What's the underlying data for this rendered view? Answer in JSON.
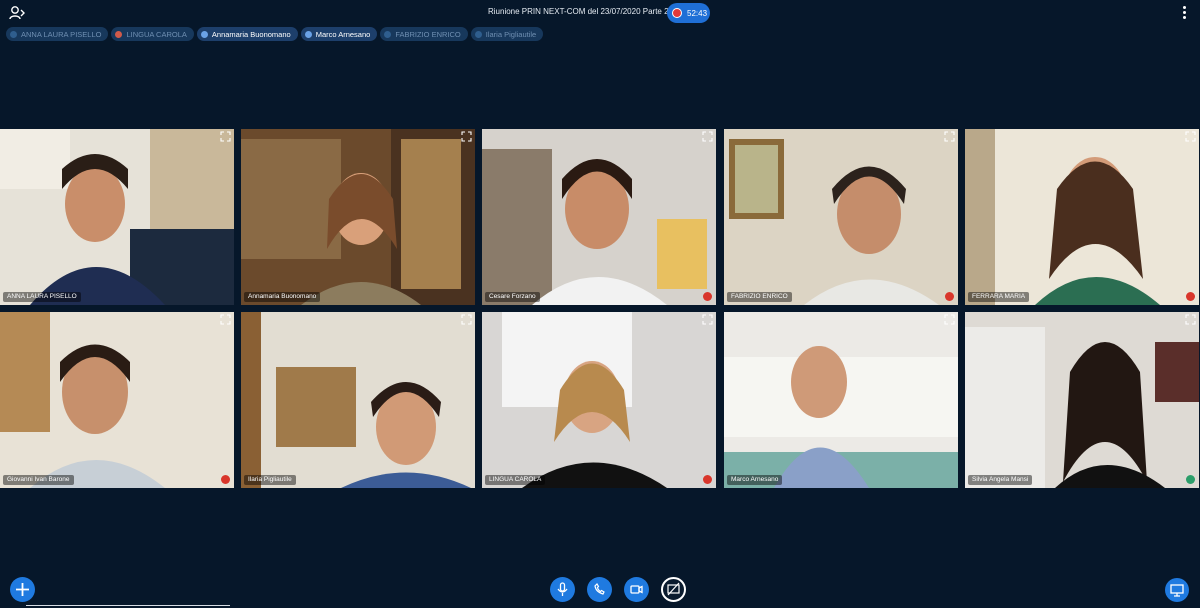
{
  "meeting": {
    "title": "Riunione PRIN NEXT-COM del 23/07/2020 Parte 2",
    "timer": "52:43"
  },
  "participant_pills": [
    {
      "label": "ANNA LAURA PISELLO",
      "active": false
    },
    {
      "label": "LINGUA CAROLA",
      "active": false
    },
    {
      "label": "Annamaria Buonomano",
      "active": true
    },
    {
      "label": "Marco Arnesano",
      "active": true
    },
    {
      "label": "FABRIZIO ENRICO",
      "active": false
    },
    {
      "label": "Ilaria Pigliautile",
      "active": false
    }
  ],
  "tiles": [
    {
      "name": "ANNA LAURA PISELLO",
      "status": "none"
    },
    {
      "name": "Annamaria Buonomano",
      "status": "none"
    },
    {
      "name": "Cesare Forzano",
      "status": "muted"
    },
    {
      "name": "FABRIZIO ENRICO",
      "status": "muted"
    },
    {
      "name": "FERRARA MARIA",
      "status": "muted"
    },
    {
      "name": "Giovanni Ivan Barone",
      "status": "muted"
    },
    {
      "name": "Ilaria Pigliautile",
      "status": "none"
    },
    {
      "name": "LINGUA CAROLA",
      "status": "muted"
    },
    {
      "name": "Marco Arnesano",
      "status": "none"
    },
    {
      "name": "Silvia Angela Mansi",
      "status": "talking"
    }
  ],
  "icons": {
    "users": "users-icon",
    "more": "kebab-icon",
    "expand": "expand-icon",
    "add": "plus-icon",
    "mic": "microphone-icon",
    "hangup": "hang-up-icon",
    "camera": "video-camera-icon",
    "screen_share": "screen-share-icon",
    "presentation": "presentation-icon"
  },
  "colors": {
    "background": "#06172a",
    "accent": "#1f7ae0",
    "muted": "#d9362b",
    "talking": "#2c9e6a"
  }
}
